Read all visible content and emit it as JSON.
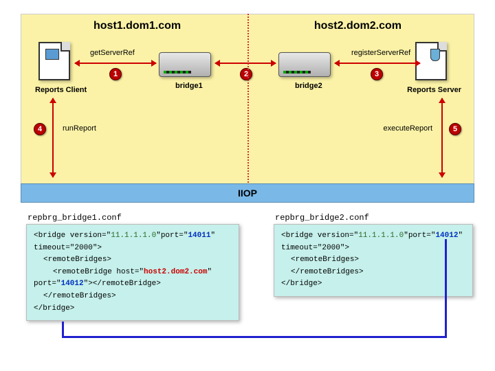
{
  "hosts": {
    "left": "host1.dom1.com",
    "right": "host2.dom2.com"
  },
  "nodes": {
    "client_label": "Reports Client",
    "server_label": "Reports Server",
    "bridge1_label": "bridge1",
    "bridge2_label": "bridge2"
  },
  "arrows": {
    "get_server_ref": "getServerRef",
    "register_server_ref": "registerServerRef",
    "run_report": "runReport",
    "execute_report": "executeReport"
  },
  "badges": {
    "b1": "1",
    "b2": "2",
    "b3": "3",
    "b4": "4",
    "b5": "5"
  },
  "iiop": "IIOP",
  "conf": {
    "left_title": "repbrg_bridge1.conf",
    "right_title": "repbrg_bridge2.conf",
    "version": "11.1.1.1.0",
    "port1": "14011",
    "port2": "14012",
    "timeout": "2000",
    "remote_host": "host2.dom2.com",
    "remote_port": "14012",
    "bridge_open_a": "<bridge version=\"",
    "bridge_open_b": "\"port=\"",
    "bridge_open_c": "\"",
    "timeout_a": "timeout=\"",
    "timeout_b": "\">",
    "rb_open": "<remoteBridges>",
    "rb_close": "</remoteBridges>",
    "rbridge_a": "<remoteBridge host=\"",
    "rbridge_b": "\"",
    "rbridge_c": "port=\"",
    "rbridge_d": "\"></remoteBridge>",
    "bridge_close": "</bridge>"
  }
}
